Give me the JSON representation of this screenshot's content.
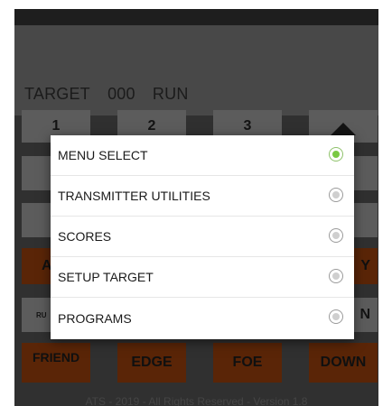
{
  "status_line": {
    "target_label": "TARGET",
    "target_number": "000",
    "mode": "RUN"
  },
  "keypad": {
    "row1": [
      "1",
      "2",
      "3"
    ],
    "row4": {
      "left_partial": "A",
      "right_partial": "Y"
    },
    "row5": {
      "left_small": "RU",
      "right_partial": "N"
    },
    "bottom": [
      "FRIEND",
      "EDGE",
      "FOE",
      "DOWN"
    ]
  },
  "footer": {
    "text": "ATS - 2019 - All Rights Reserved - Version 1.8"
  },
  "menu": {
    "items": [
      {
        "label": "MENU SELECT",
        "selected": true
      },
      {
        "label": "TRANSMITTER UTILITIES",
        "selected": false
      },
      {
        "label": "SCORES",
        "selected": false
      },
      {
        "label": "SETUP TARGET",
        "selected": false
      },
      {
        "label": "PROGRAMS",
        "selected": false
      }
    ]
  },
  "colors": {
    "accent_selected": "#7ac943",
    "orange_key": "#8a3a0b",
    "gray_key": "#8e8e8e"
  }
}
